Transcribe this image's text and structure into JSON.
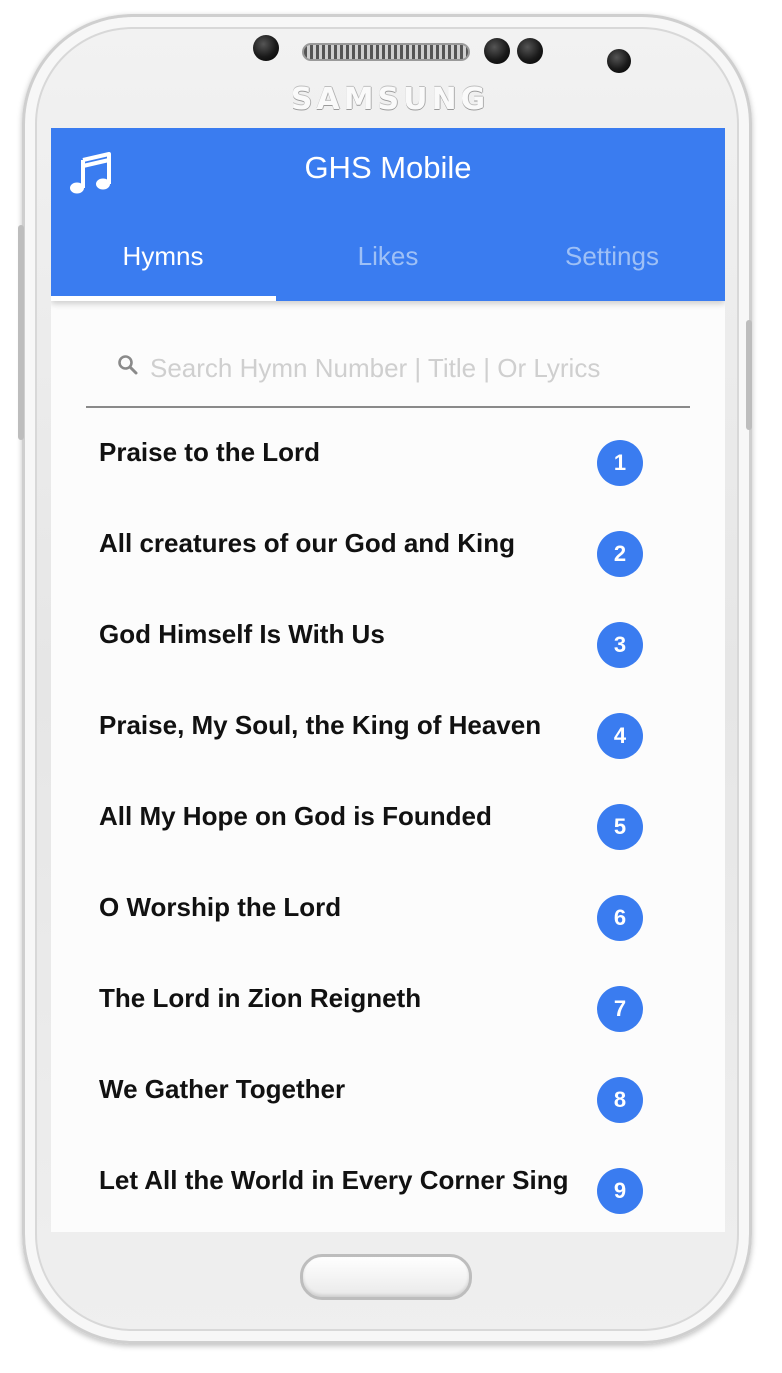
{
  "device": {
    "brand": "SAMSUNG"
  },
  "app": {
    "title": "GHS Mobile",
    "icon": "music-note-icon",
    "accent_color": "#3a7cf0"
  },
  "tabs": [
    {
      "label": "Hymns",
      "active": true
    },
    {
      "label": "Likes",
      "active": false
    },
    {
      "label": "Settings",
      "active": false
    }
  ],
  "search": {
    "placeholder": "Search Hymn Number | Title | Or Lyrics",
    "value": ""
  },
  "hymns": [
    {
      "title": "Praise to the Lord",
      "number": "1"
    },
    {
      "title": "All creatures of our God and King",
      "number": "2"
    },
    {
      "title": "God Himself Is With Us",
      "number": "3"
    },
    {
      "title": "Praise, My Soul, the King of Heaven",
      "number": "4"
    },
    {
      "title": "All My Hope on God is Founded",
      "number": "5"
    },
    {
      "title": "O Worship the Lord",
      "number": "6"
    },
    {
      "title": "The Lord in Zion Reigneth",
      "number": "7"
    },
    {
      "title": "We Gather Together",
      "number": "8"
    },
    {
      "title": "Let All the World in Every Corner Sing",
      "number": "9"
    }
  ]
}
